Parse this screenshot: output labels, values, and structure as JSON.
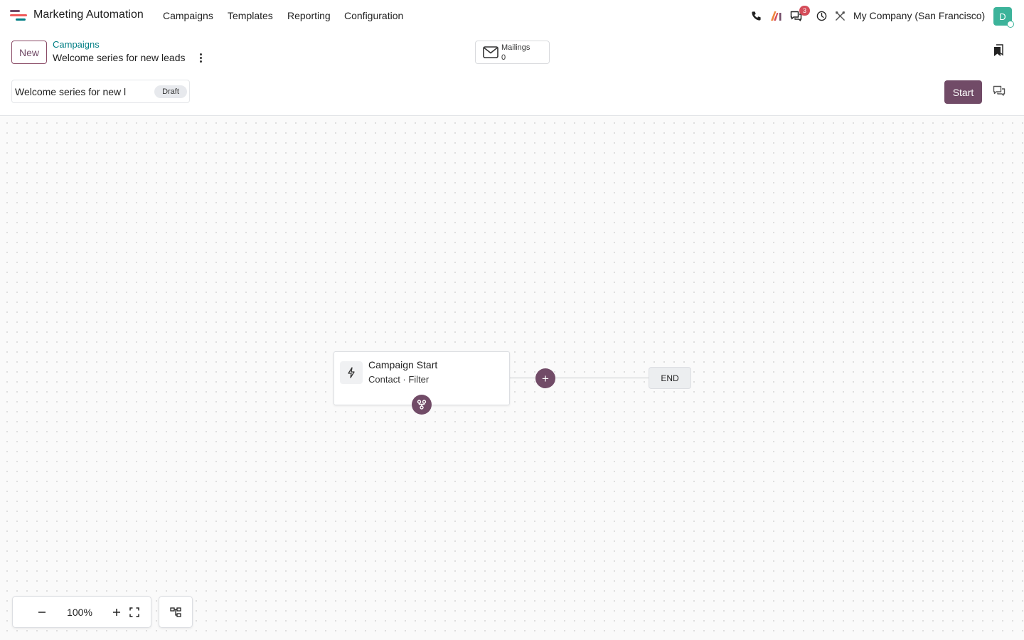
{
  "app": {
    "name": "Marketing Automation",
    "logo_colors": [
      "#f05a5a",
      "#714b67",
      "#017e84"
    ]
  },
  "navbar": {
    "menu": [
      "Campaigns",
      "Templates",
      "Reporting",
      "Configuration"
    ],
    "icons": [
      "phone-icon",
      "ai-icon",
      "messages-icon",
      "activity-clock-icon",
      "debug-tools-icon"
    ],
    "messages_count": "3",
    "company": "My Company (San Francisco)",
    "avatar_initial": "D"
  },
  "control_panel": {
    "new_label": "New",
    "breadcrumb_parent": "Campaigns",
    "breadcrumb_current": "Welcome series for new leads",
    "smart_button": {
      "label": "Mailings",
      "value": "0"
    },
    "name_value": "Welcome series for new l",
    "status": "Draft",
    "start_label": "Start"
  },
  "canvas": {
    "node": {
      "title": "Campaign Start",
      "subtitle": "Contact · Filter"
    },
    "end_label": "END",
    "zoom": "100%"
  },
  "colors": {
    "primary": "#714b67",
    "link": "#017e84",
    "badge": "#d44c59",
    "avatar": "#3cb39a"
  }
}
